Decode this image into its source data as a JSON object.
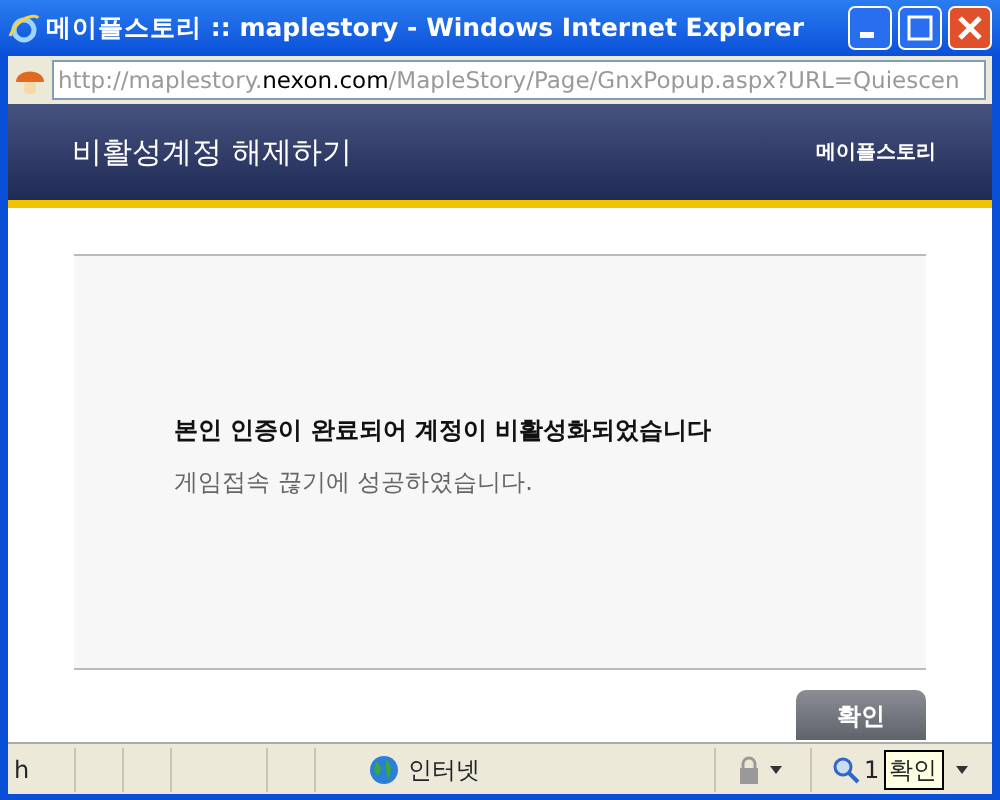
{
  "window": {
    "title": "메이플스토리 :: maplestory - Windows Internet Explorer"
  },
  "address_bar": {
    "url_prefix": "http://maplestory.",
    "url_domain": "nexon.com",
    "url_path": "/MapleStory/Page/GnxPopup.aspx?URL=Quiescen"
  },
  "header": {
    "title": "비활성계정 해제하기",
    "logo": "메이플스토리"
  },
  "message": {
    "headline": "본인 인증이 완료되어 계정이 비활성화되었습니다",
    "detail": "게임접속 끊기에 성공하였습니다."
  },
  "buttons": [
    "확인"
  ],
  "status_bar": {
    "text": "h",
    "zone": "인터넷",
    "zoom": "1",
    "tooltip": "확인"
  }
}
